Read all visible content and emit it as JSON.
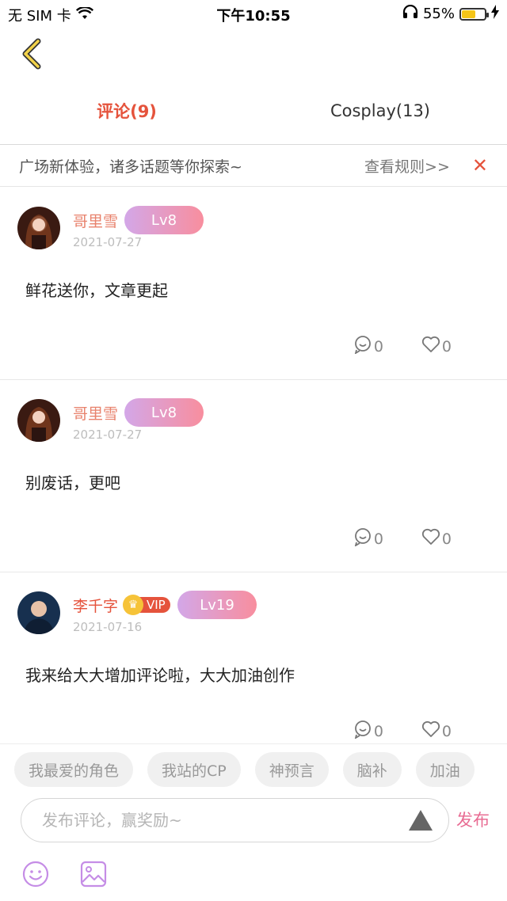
{
  "status_bar": {
    "carrier": "无 SIM 卡",
    "time": "下午10:55",
    "battery_percent": "55%",
    "battery_level": 0.55
  },
  "tabs": [
    {
      "label": "评论(9)",
      "active": true
    },
    {
      "label": "Cosplay(13)",
      "active": false
    }
  ],
  "banner": {
    "text": "广场新体验，诸多话题等你探索~",
    "rule_link": "查看规则>>",
    "close_icon": "close-icon"
  },
  "comments": [
    {
      "user": "哥里雪",
      "vip": false,
      "level": "Lv8",
      "date": "2021-07-27",
      "content": "鲜花送你，文章更起",
      "reply_count": "0",
      "like_count": "0"
    },
    {
      "user": "哥里雪",
      "vip": false,
      "level": "Lv8",
      "date": "2021-07-27",
      "content": "别废话，更吧",
      "reply_count": "0",
      "like_count": "0"
    },
    {
      "user": "李千字",
      "vip": true,
      "vip_label": "VIP",
      "level": "Lv19",
      "date": "2021-07-16",
      "content": "我来给大大增加评论啦，大大加油创作",
      "reply_count": "0",
      "like_count": "0"
    }
  ],
  "chips": [
    "我最爱的角色",
    "我站的CP",
    "神预言",
    "脑补",
    "加油"
  ],
  "composer": {
    "placeholder": "发布评论，赢奖励~",
    "publish_label": "发布"
  },
  "colors": {
    "accent": "#e5533c",
    "publish": "#e86c93",
    "tool_icon": "#c58de6"
  }
}
